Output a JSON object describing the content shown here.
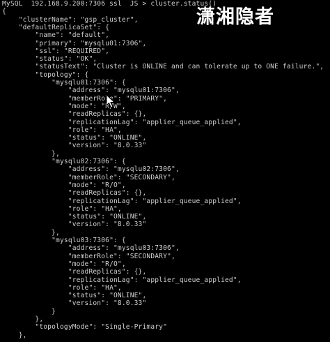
{
  "terminal": {
    "lines": [
      "MySQL  192.168.9.200:7306 ssl  JS > cluster.status()",
      "{",
      "    \"clusterName\": \"gsp_cluster\",",
      "    \"defaultReplicaSet\": {",
      "        \"name\": \"default\",",
      "        \"primary\": \"mysqlu01:7306\",",
      "        \"ssl\": \"REQUIRED\",",
      "        \"status\": \"OK\",",
      "        \"statusText\": \"Cluster is ONLINE and can tolerate up to ONE failure.\",",
      "        \"topology\": {",
      "            \"mysqlu01:7306\": {",
      "                \"address\": \"mysqlu01:7306\",",
      "                \"memberRole\": \"PRIMARY\",",
      "                \"mode\": \"R/W\",",
      "                \"readReplicas\": {},",
      "                \"replicationLag\": \"applier_queue_applied\",",
      "                \"role\": \"HA\",",
      "                \"status\": \"ONLINE\",",
      "                \"version\": \"8.0.33\"",
      "            },",
      "            \"mysqlu02:7306\": {",
      "                \"address\": \"mysqlu02:7306\",",
      "                \"memberRole\": \"SECONDARY\",",
      "                \"mode\": \"R/O\",",
      "                \"readReplicas\": {},",
      "                \"replicationLag\": \"applier_queue_applied\",",
      "                \"role\": \"HA\",",
      "                \"status\": \"ONLINE\",",
      "                \"version\": \"8.0.33\"",
      "            },",
      "            \"mysqlu03:7306\": {",
      "                \"address\": \"mysqlu03:7306\",",
      "                \"memberRole\": \"SECONDARY\",",
      "                \"mode\": \"R/O\",",
      "                \"readReplicas\": {},",
      "                \"replicationLag\": \"applier_queue_applied\",",
      "                \"role\": \"HA\",",
      "                \"status\": \"ONLINE\",",
      "                \"version\": \"8.0.33\"",
      "            }",
      "        },",
      "        \"topologyMode\": \"Single-Primary\"",
      "    },"
    ]
  },
  "watermark": "潇湘隐者",
  "colors": {
    "background": "#000000",
    "text": "#cfcfcf",
    "watermark": "#ffffff"
  },
  "icons": {
    "cursor": "mouse-pointer-icon"
  }
}
